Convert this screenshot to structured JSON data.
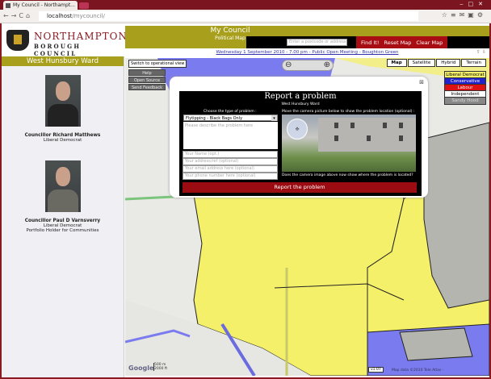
{
  "browser": {
    "tab_title": "My Council - Northampt...",
    "url_host": "localhost",
    "url_path": "/mycouncil/"
  },
  "header": {
    "logo_line1": "NORTHAMPTON",
    "logo_line2": "BOROUGH COUNCIL",
    "title": "My Council",
    "subtitle": "Political Map",
    "search_placeholder": "Enter a postcode or address",
    "find_label": "Find It!",
    "reset_label": "Reset Map",
    "clear_label": "Clear Map",
    "event_link": "Wednesday 1 September 2010 - 7.00 pm - Public Open Meeting - Boughton Green"
  },
  "sidebar": {
    "ward": "West Hunsbury Ward",
    "councillors": [
      {
        "name": "Councillor Richard Matthews",
        "party": "Liberal Democrat",
        "role": ""
      },
      {
        "name": "Councillor Paul D Varnsverry",
        "party": "Liberal Democrat",
        "role": "Portfolio Holder for Communities"
      }
    ]
  },
  "map": {
    "switch_view": "Switch to operational view",
    "buttons": [
      "Help",
      "Open Source",
      "Send Feedback"
    ],
    "map_types": [
      "Map",
      "Satellite",
      "Hybrid",
      "Terrain"
    ],
    "active_map_type": "Map",
    "legend": [
      {
        "label": "Liberal Democrat",
        "color": "#f5f06a"
      },
      {
        "label": "Conservative",
        "color": "#2222cc"
      },
      {
        "label": "Labour",
        "color": "#dd1111"
      },
      {
        "label": "Independent",
        "color": "#ffffff"
      },
      {
        "label": "Sandy Hood",
        "color": "#888888"
      }
    ],
    "scale_m": "500 m",
    "scale_ft": "2000 ft",
    "version": "v1.07",
    "copyright": "Map data ©2010 Tele Atlas -",
    "google": "Google"
  },
  "dialog": {
    "title": "Report a problem",
    "ward": "West Hunsbury Ward",
    "type_label": "Choose the type of problem :",
    "selected_type": "Flytipping - Black Bags Only",
    "describe_placeholder": "Please describe the problem here",
    "name_placeholder": "Your Name (opt.)",
    "address_placeholder": "Your address/ref (optional)",
    "email_placeholder": "Your email address here (optional)",
    "phone_placeholder": "Your phone number here (optional)",
    "camera_label": "Move the camera picture below to show the problem location (optional) :",
    "camera_question": "Does the camera image above now show where the problem is located?",
    "submit": "Report the problem"
  }
}
